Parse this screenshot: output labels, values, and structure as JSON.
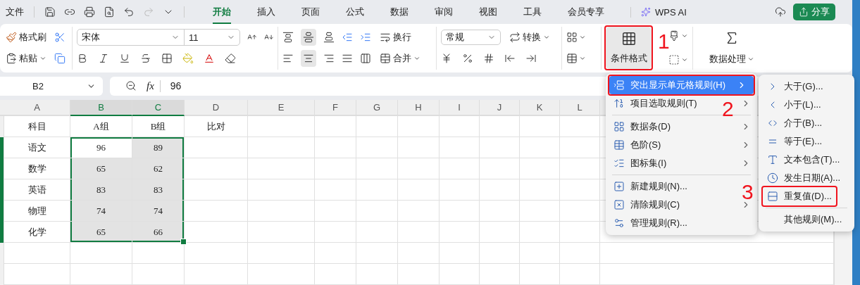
{
  "file_menu": "文件",
  "tabs": [
    {
      "label": "开始",
      "selected": true
    },
    {
      "label": "插入",
      "selected": false
    },
    {
      "label": "页面",
      "selected": false
    },
    {
      "label": "公式",
      "selected": false
    },
    {
      "label": "数据",
      "selected": false
    },
    {
      "label": "审阅",
      "selected": false
    },
    {
      "label": "视图",
      "selected": false
    },
    {
      "label": "工具",
      "selected": false
    },
    {
      "label": "会员专享",
      "selected": false
    }
  ],
  "ai_button": "WPS AI",
  "share_button": "分享",
  "ribbon": {
    "format_painter": "格式刷",
    "paste": "粘贴",
    "font_name": "宋体",
    "font_size": "11",
    "wrap": "换行",
    "merge": "合并",
    "number_format": "常规",
    "convert": "转换",
    "conditional_format": {
      "label": "条件格式",
      "callout": "1"
    },
    "data_processing": "数据处理"
  },
  "formula_bar": {
    "name_box": "B2",
    "fx": "fx",
    "value": "96"
  },
  "sheet": {
    "columns": [
      {
        "label": "A",
        "selected": false
      },
      {
        "label": "B",
        "selected": true
      },
      {
        "label": "C",
        "selected": true
      },
      {
        "label": "D",
        "selected": false
      },
      {
        "label": "E",
        "selected": false
      },
      {
        "label": "F",
        "selected": false
      },
      {
        "label": "G",
        "selected": false
      },
      {
        "label": "H",
        "selected": false
      },
      {
        "label": "I",
        "selected": false
      },
      {
        "label": "J",
        "selected": false
      },
      {
        "label": "K",
        "selected": false
      },
      {
        "label": "L",
        "selected": false
      }
    ],
    "rows": [
      {
        "selected": false,
        "cells": [
          {
            "text": "科目",
            "selected": false
          },
          {
            "text": "A组",
            "selected": false
          },
          {
            "text": "B组",
            "selected": false
          },
          {
            "text": "比对",
            "selected": false
          }
        ]
      },
      {
        "selected": true,
        "cells": [
          {
            "text": "语文",
            "selected": false
          },
          {
            "text": "96",
            "selected": false
          },
          {
            "text": "89",
            "selected": true
          }
        ]
      },
      {
        "selected": true,
        "cells": [
          {
            "text": "数学",
            "selected": false
          },
          {
            "text": "65",
            "selected": true
          },
          {
            "text": "62",
            "selected": true
          }
        ]
      },
      {
        "selected": true,
        "cells": [
          {
            "text": "英语",
            "selected": false
          },
          {
            "text": "83",
            "selected": true
          },
          {
            "text": "83",
            "selected": true
          }
        ]
      },
      {
        "selected": true,
        "cells": [
          {
            "text": "物理",
            "selected": false
          },
          {
            "text": "74",
            "selected": true
          },
          {
            "text": "74",
            "selected": true
          }
        ]
      },
      {
        "selected": true,
        "cells": [
          {
            "text": "化学",
            "selected": false
          },
          {
            "text": "65",
            "selected": true
          },
          {
            "text": "66",
            "selected": true
          }
        ]
      }
    ]
  },
  "menu": {
    "items": [
      {
        "kind": "item",
        "label": "突出显示单元格规则(H)",
        "submenu": true,
        "selected": true,
        "callout": "2"
      },
      {
        "kind": "item",
        "label": "项目选取规则(T)",
        "submenu": true,
        "selected": false
      },
      {
        "kind": "separator"
      },
      {
        "kind": "item",
        "label": "数据条(D)",
        "submenu": true,
        "selected": false
      },
      {
        "kind": "item",
        "label": "色阶(S)",
        "submenu": true,
        "selected": false
      },
      {
        "kind": "item",
        "label": "图标集(I)",
        "submenu": true,
        "selected": false
      },
      {
        "kind": "separator"
      },
      {
        "kind": "item",
        "label": "新建规则(N)...",
        "submenu": false,
        "selected": false
      },
      {
        "kind": "item",
        "label": "清除规则(C)",
        "submenu": true,
        "selected": false
      },
      {
        "kind": "item",
        "label": "管理规则(R)...",
        "submenu": false,
        "selected": false
      }
    ]
  },
  "submenu": {
    "items": [
      {
        "kind": "item",
        "label": "大于(G)..."
      },
      {
        "kind": "item",
        "label": "小于(L)..."
      },
      {
        "kind": "item",
        "label": "介于(B)..."
      },
      {
        "kind": "item",
        "label": "等于(E)..."
      },
      {
        "kind": "item",
        "label": "文本包含(T)..."
      },
      {
        "kind": "item",
        "label": "发生日期(A)..."
      },
      {
        "kind": "item",
        "label": "重复值(D)...",
        "callout": "3"
      },
      {
        "kind": "separator"
      },
      {
        "kind": "item",
        "label": "其他规则(M)..."
      }
    ]
  }
}
